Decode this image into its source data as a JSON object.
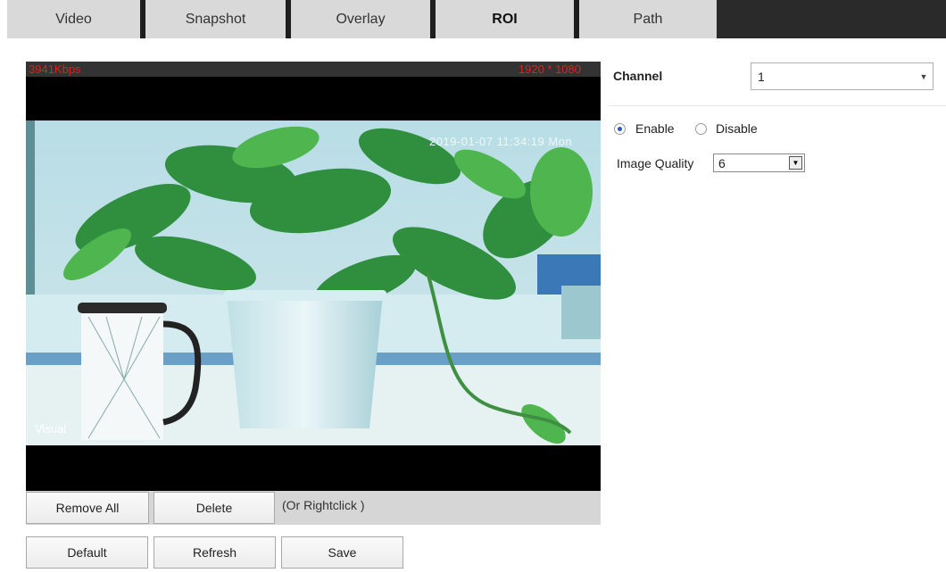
{
  "tabs": [
    {
      "label": "Video",
      "active": false
    },
    {
      "label": "Snapshot",
      "active": false
    },
    {
      "label": "Overlay",
      "active": false
    },
    {
      "label": "ROI",
      "active": true
    },
    {
      "label": "Path",
      "active": false
    }
  ],
  "video": {
    "bitrate": "3941Kbps",
    "resolution": "1920 * 1080",
    "timestamp": "2019-01-07 11:34:19 Mon",
    "channel_name": "Visual"
  },
  "roi_toolbar": {
    "remove_all_label": "Remove All",
    "delete_label": "Delete",
    "hint": "(Or Rightclick )"
  },
  "footer": {
    "default_label": "Default",
    "refresh_label": "Refresh",
    "save_label": "Save"
  },
  "settings": {
    "channel_label": "Channel",
    "channel_value": "1",
    "enable_label": "Enable",
    "disable_label": "Disable",
    "enabled": true,
    "image_quality_label": "Image Quality",
    "image_quality_value": "6"
  },
  "colors": {
    "overlay_text": "#e02020",
    "active_radio": "#2a5bb8",
    "tab_background": "#d9d9d9"
  }
}
